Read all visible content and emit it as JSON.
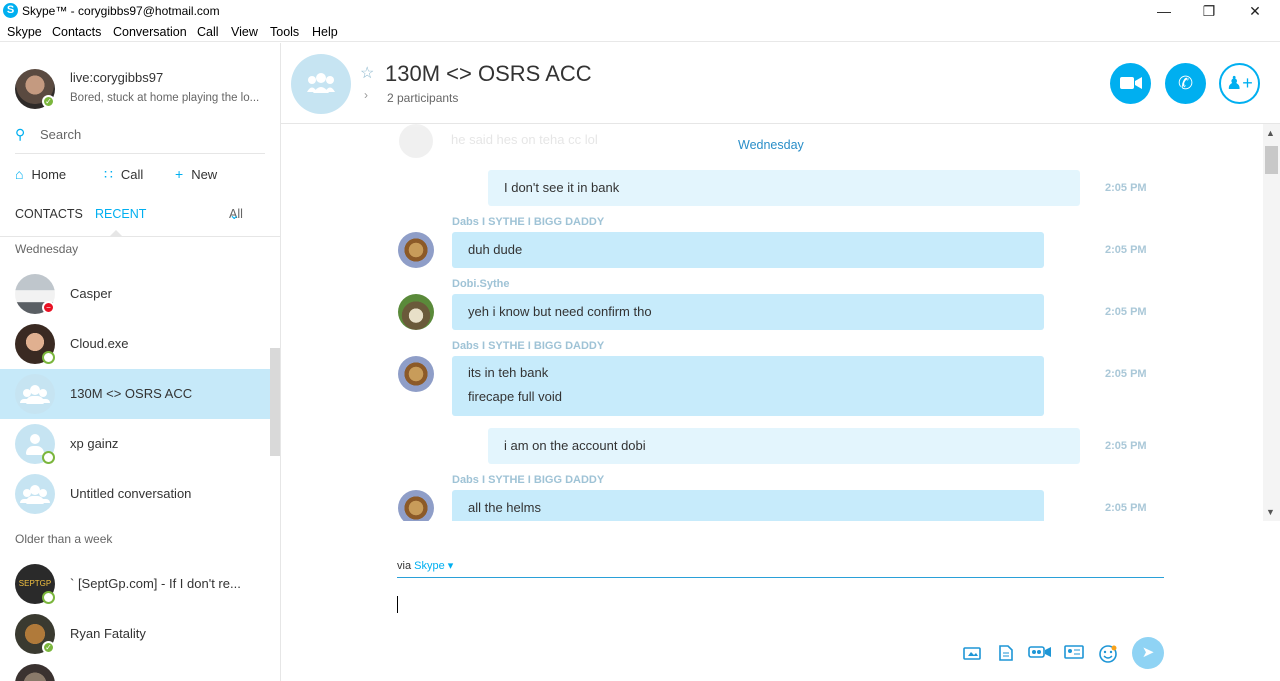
{
  "window": {
    "title": "Skype™ - corygibbs97@hotmail.com",
    "minimize": "—",
    "restore": "❐",
    "close": "✕"
  },
  "menu": [
    "Skype",
    "Contacts",
    "Conversation",
    "Call",
    "View",
    "Tools",
    "Help"
  ],
  "profile": {
    "name": "live:corygibbs97",
    "mood": "Bored, stuck at home playing the lo..."
  },
  "search": {
    "label": "Search"
  },
  "nav": {
    "home": "Home",
    "call": "Call",
    "new": "New"
  },
  "tabs": {
    "contacts": "CONTACTS",
    "recent": "RECENT",
    "filter": "All"
  },
  "recent": {
    "section1": "Wednesday",
    "section2": "Older than a week",
    "items": [
      {
        "name": "Casper",
        "status": "busy"
      },
      {
        "name": "Cloud.exe",
        "status": "away"
      },
      {
        "name": "130M <> OSRS ACC",
        "status": "group"
      },
      {
        "name": "xp gainz",
        "status": "away"
      },
      {
        "name": "Untitled conversation",
        "status": "group"
      },
      {
        "name": "` [SeptGp.com] - If I don't re...",
        "status": "away"
      },
      {
        "name": "Ryan Fatality",
        "status": "online"
      }
    ]
  },
  "conversation": {
    "title": "130M <> OSRS ACC",
    "participants": "2 participants",
    "day": "Wednesday",
    "faded_message": "he said hes on teha cc lol",
    "messages": [
      {
        "sender": "",
        "lines": [
          "I don't see it in bank"
        ],
        "time": "2:05 PM",
        "outgoing": true
      },
      {
        "sender": "Dabs I SYTHE I BIGG DADDY",
        "lines": [
          "duh dude"
        ],
        "time": "2:05 PM",
        "outgoing": false
      },
      {
        "sender": "Dobi.Sythe",
        "lines": [
          "yeh i know but need confirm tho"
        ],
        "time": "2:05 PM",
        "outgoing": false
      },
      {
        "sender": "Dabs I SYTHE I BIGG DADDY",
        "lines": [
          "its in teh bank",
          "firecape full void"
        ],
        "time": "2:05 PM",
        "outgoing": false
      },
      {
        "sender": "",
        "lines": [
          "i am on the account dobi"
        ],
        "time": "2:05 PM",
        "outgoing": true
      },
      {
        "sender": "Dabs I SYTHE I BIGG DADDY",
        "lines": [
          "all the helms"
        ],
        "time": "2:05 PM",
        "outgoing": false
      }
    ]
  },
  "compose": {
    "via": "via",
    "network": "Skype ▾"
  },
  "colors": {
    "accent": "#00aff0",
    "bubble_in": "#c7ebfb",
    "bubble_out": "#e3f5fd",
    "selected": "#c6e9f9"
  }
}
